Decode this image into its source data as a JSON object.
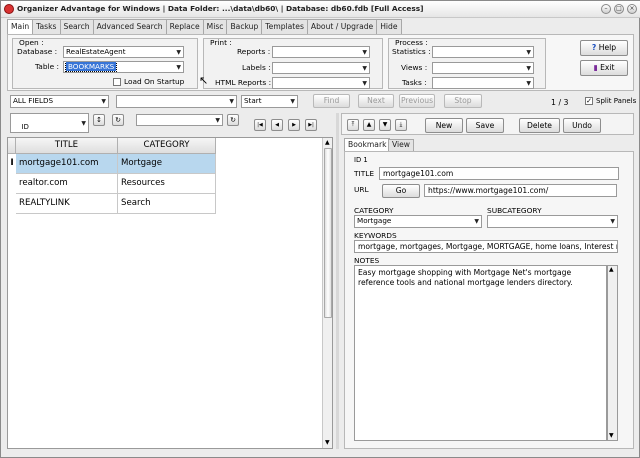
{
  "window": {
    "title": "Organizer Advantage for Windows | Data Folder: ...\\data\\db60\\ | Database: db60.fdb [Full Access]"
  },
  "tabs": [
    "Main",
    "Tasks",
    "Search",
    "Advanced Search",
    "Replace",
    "Misc",
    "Backup",
    "Templates",
    "About / Upgrade",
    "Hide"
  ],
  "open_group": {
    "title": "Open :",
    "database_label": "Database :",
    "database_value": "RealEstateAgent",
    "table_label": "Table :",
    "table_value": "BOOKMARKS",
    "load_on_startup_label": "Load On Startup"
  },
  "print_group": {
    "title": "Print :",
    "reports_label": "Reports :",
    "labels_label": "Labels :",
    "html_reports_label": "HTML Reports :"
  },
  "process_group": {
    "title": "Process :",
    "statistics_label": "Statistics :",
    "views_label": "Views :",
    "tasks_label": "Tasks :"
  },
  "help_button": "Help",
  "exit_button": "Exit",
  "search_bar": {
    "field_value": "ALL FIELDS",
    "position_value": "Start",
    "find": "Find",
    "next": "Next",
    "previous": "Previous",
    "stop": "Stop",
    "record_count": "1 / 3",
    "split_panels_label": "Split Panels"
  },
  "sort_bar": {
    "sort_value": "ID\nD"
  },
  "grid": {
    "columns": [
      "TITLE",
      "CATEGORY"
    ],
    "rows": [
      {
        "title": "mortgage101.com",
        "category": "Mortgage"
      },
      {
        "title": "realtor.com",
        "category": "Resources"
      },
      {
        "title": "REALTYLINK",
        "category": "Search"
      }
    ]
  },
  "record_actions": {
    "new": "New",
    "save": "Save",
    "delete": "Delete",
    "undo": "Undo"
  },
  "detail_tabs": [
    "Bookmark",
    "View"
  ],
  "record": {
    "id_label": "ID 1",
    "title_label": "TITLE",
    "title_value": "mortgage101.com",
    "url_label": "URL",
    "go_button": "Go",
    "url_value": "https://www.mortgage101.com/",
    "category_label": "CATEGORY",
    "category_value": "Mortgage",
    "subcategory_label": "SUBCATEGORY",
    "subcategory_value": "",
    "keywords_label": "KEYWORDS",
    "keywords_value": "mortgage, mortgages, Mortgage, MORTGAGE, home loans, Interest rate",
    "notes_label": "NOTES",
    "notes_value": "Easy mortgage shopping with Mortgage Net's mortgage reference tools and national mortgage lenders directory."
  },
  "colors": {
    "selection": "#3875d7",
    "grid_selection": "#b8d7ee",
    "app_icon": "#d93232"
  }
}
